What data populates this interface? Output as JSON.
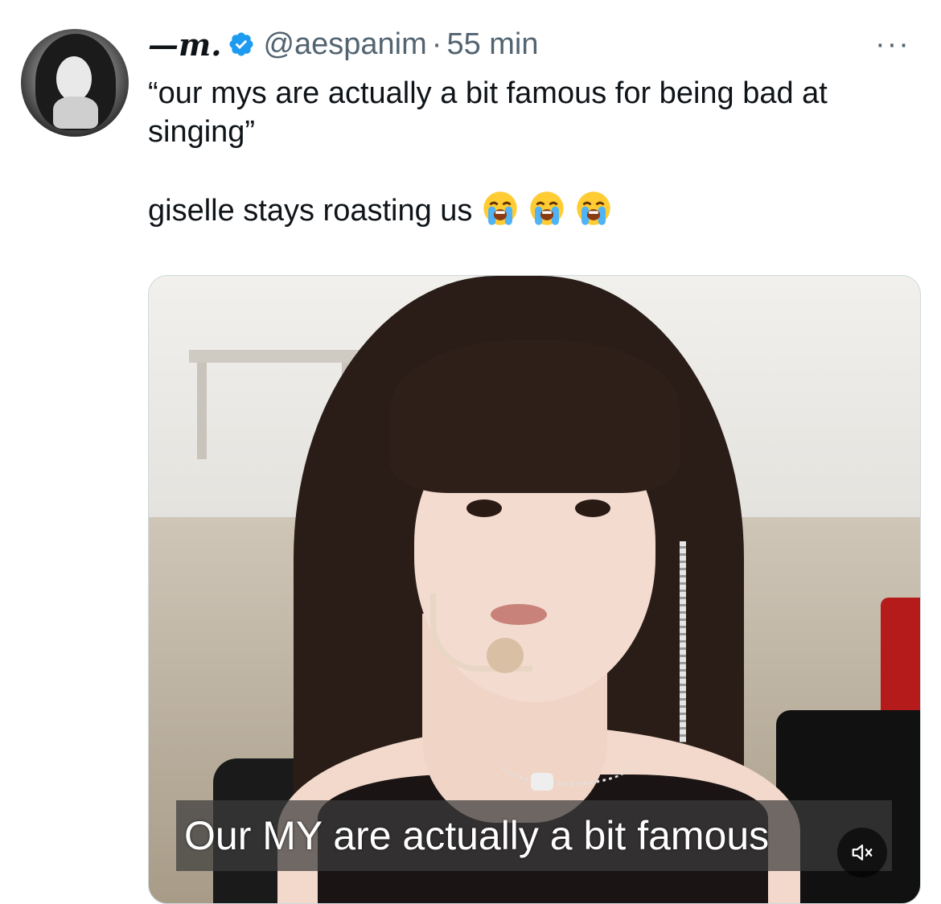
{
  "tweet": {
    "display_name": "—m.",
    "handle": "@aespanim",
    "separator": "·",
    "time": "55 min",
    "more_label": "···",
    "text_line1": "“our mys are actually a bit famous for being bad at singing”",
    "text_line2": "giselle stays roasting us",
    "emoji": [
      "loudly-crying-face",
      "loudly-crying-face",
      "loudly-crying-face"
    ]
  },
  "media": {
    "caption": "Our MY are actually a bit famous",
    "mute_icon": "volume-muted-icon"
  },
  "colors": {
    "text_primary": "#0f1419",
    "text_secondary": "#536471",
    "verified_blue": "#1d9bf0"
  }
}
